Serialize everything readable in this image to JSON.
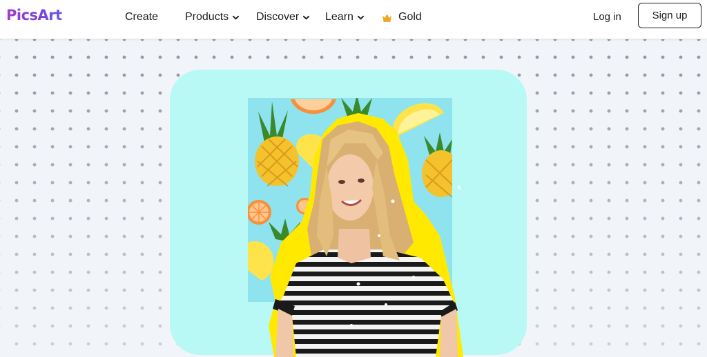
{
  "header": {
    "logo": "PicsArt",
    "nav": [
      {
        "label": "Create",
        "has_dropdown": false
      },
      {
        "label": "Products",
        "has_dropdown": true
      },
      {
        "label": "Discover",
        "has_dropdown": true
      },
      {
        "label": "Learn",
        "has_dropdown": true
      },
      {
        "label": "Gold",
        "icon": "crown-icon",
        "has_dropdown": false
      }
    ],
    "login": "Log in",
    "signup": "Sign up"
  },
  "colors": {
    "brand": "#7b3fd1",
    "card_background": "#b8f9f6",
    "photo_background": "#8fe3ee",
    "sticker_outline": "#ffe900",
    "crown": "#f2a81d"
  }
}
